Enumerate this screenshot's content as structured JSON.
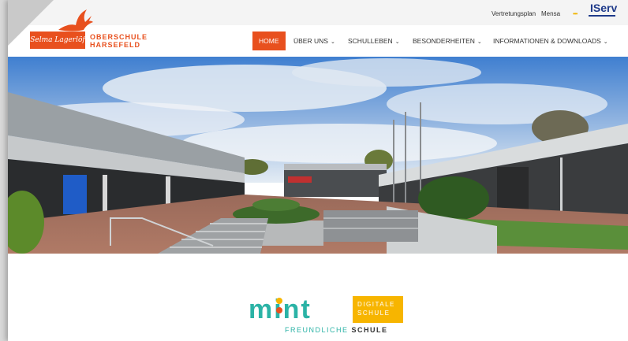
{
  "topbar": {
    "links": [
      "Vertretungsplan",
      "Mensa"
    ],
    "iserv_label": "IServ"
  },
  "logo": {
    "box_text": "Selma Lagerlöf",
    "line1": "OBERSCHULE",
    "line2": "HARSEFELD"
  },
  "nav": {
    "items": [
      {
        "label": "HOME",
        "active": true
      },
      {
        "label": "ÜBER UNS",
        "dropdown": true
      },
      {
        "label": "SCHULLEBEN",
        "dropdown": true
      },
      {
        "label": "BESONDERHEITEN",
        "dropdown": true
      },
      {
        "label": "INFORMATIONEN & DOWNLOADS",
        "dropdown": true
      }
    ]
  },
  "mint": {
    "word": "mint",
    "sub_teal": "FREUNDLICHE",
    "sub_dark": "SCHULE",
    "badge_line1": "DIGITALE",
    "badge_line2": "SCHULE"
  },
  "colors": {
    "brand": "#e8501e",
    "mint_teal": "#2bb3a6",
    "digital_yellow": "#f7b500",
    "iserv_blue": "#1e3a8a"
  }
}
